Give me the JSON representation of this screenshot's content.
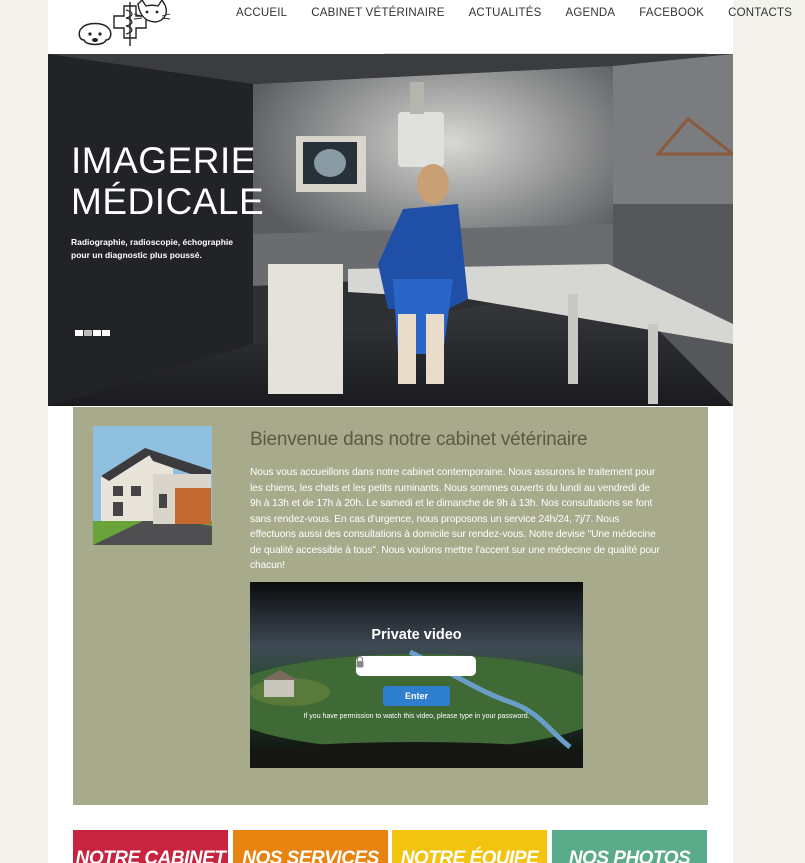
{
  "nav": {
    "items": [
      "ACCUEIL",
      "CABINET VÉTÉRINAIRE",
      "ACTUALITÉS",
      "AGENDA",
      "FACEBOOK",
      "CONTACTS"
    ]
  },
  "hero": {
    "title_line1": "IMAGERIE",
    "title_line2": "MÉDICALE",
    "subtitle": "Radiographie, radioscopie, échographie pour un diagnostic plus poussé.",
    "slide_count": 4,
    "active_slide": 1
  },
  "welcome": {
    "title": "Bienvenue dans notre cabinet vétérinaire",
    "text": "Nous vous accueillons dans notre cabinet contemporaine. Nous assurons le traitement pour les chiens, les chats et les petits ruminants. Nous sommes ouverts du lundi au vendredi de 9h à 13h et de 17h à 20h. Le samedi et le dimanche de 9h à 13h. Nos consultations se font sans rendez-vous. En cas d'urgence, nous proposons un service 24h/24, 7j/7. Nous effectuons aussi des consultations à domicile sur rendez-vous. Notre devise \"Une médecine de qualité accessible à tous\". Nous voulons mettre l'accent sur une médecine de qualité pour chacun!"
  },
  "video": {
    "title": "Private video",
    "password_value": "",
    "enter_label": "Enter",
    "note": "If you have permission to watch this video, please type in your password."
  },
  "tiles": [
    {
      "label": "NOTRE CABINET",
      "color": "#c8233f"
    },
    {
      "label": "NOS SERVICES",
      "color": "#e8830f"
    },
    {
      "label": "NOTRE ÉQUIPE",
      "color": "#f2c40f"
    },
    {
      "label": "NOS PHOTOS",
      "color": "#5aab8a"
    }
  ],
  "colors": {
    "panel": "#a8aa8c",
    "page_background": "#f3f3ec",
    "enter_button": "#2f7fcf"
  }
}
